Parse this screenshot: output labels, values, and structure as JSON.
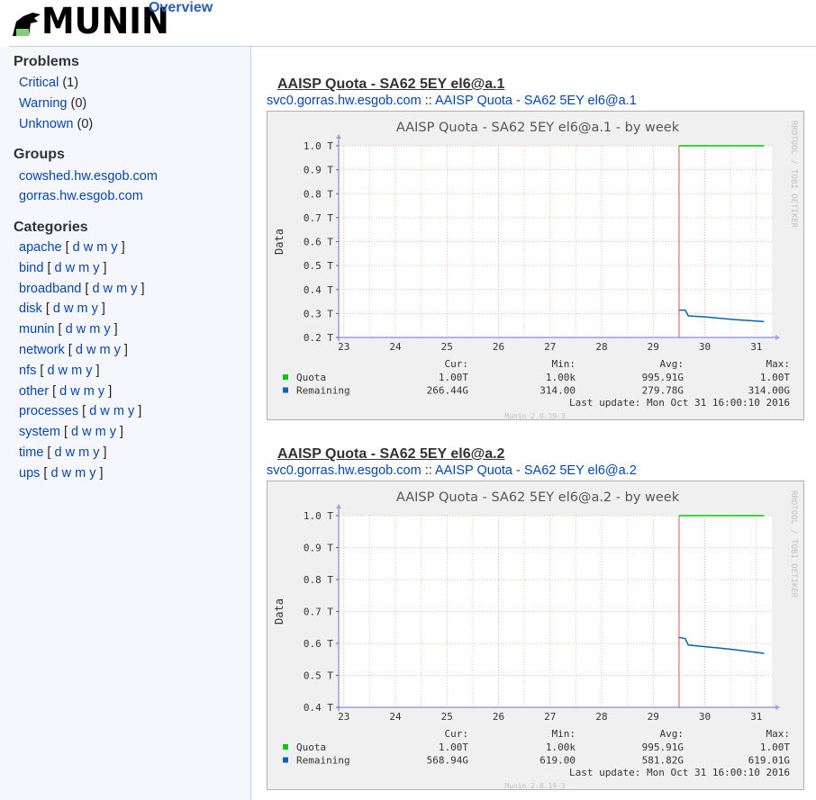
{
  "header": {
    "logo_text": "MUNIN",
    "overview_label": "Overview"
  },
  "sidebar": {
    "problems": {
      "heading": "Problems",
      "items": [
        {
          "label": "Critical",
          "count": "(1)"
        },
        {
          "label": "Warning",
          "count": "(0)"
        },
        {
          "label": "Unknown",
          "count": "(0)"
        }
      ]
    },
    "groups": {
      "heading": "Groups",
      "items": [
        "cowshed.hw.esgob.com",
        "gorras.hw.esgob.com"
      ]
    },
    "categories": {
      "heading": "Categories",
      "period_links": [
        "d",
        "w",
        "m",
        "y"
      ],
      "items": [
        "apache",
        "bind",
        "broadband",
        "disk",
        "munin",
        "network",
        "nfs",
        "other",
        "processes",
        "system",
        "time",
        "ups"
      ]
    }
  },
  "graphs": [
    {
      "title": "AAISP Quota - SA62 5EY el6@a.1",
      "crumb_host": "svc0.gorras.hw.esgob.com",
      "crumb_sep": "::",
      "crumb_service": "AAISP Quota - SA62 5EY el6@a.1",
      "chart_data": {
        "type": "line",
        "title": "AAISP Quota - SA62 5EY el6@a.1 - by week",
        "ylabel": "Data",
        "xlabel": "",
        "x_ticks": [
          "23",
          "24",
          "25",
          "26",
          "27",
          "28",
          "29",
          "30",
          "31"
        ],
        "y_ticks": [
          "1.0 T",
          "0.9 T",
          "0.8 T",
          "0.7 T",
          "0.6 T",
          "0.5 T",
          "0.4 T",
          "0.3 T",
          "0.2 T"
        ],
        "ylim": [
          0.2,
          1.0
        ],
        "xlim": [
          22.9,
          31.3
        ],
        "side_text": "RRDTOOL / TOBI OETIKER",
        "series": [
          {
            "name": "Quota",
            "color": "#00cc00",
            "x": [
              29.5,
              30.0,
              30.5,
              31.0,
              31.15
            ],
            "y": [
              1.0,
              1.0,
              1.0,
              1.0,
              1.0
            ]
          },
          {
            "name": "Remaining",
            "color": "#0066b3",
            "x": [
              29.5,
              29.62,
              29.68,
              29.85,
              30.0,
              30.3,
              30.6,
              30.9,
              31.15
            ],
            "y": [
              0.314,
              0.314,
              0.29,
              0.288,
              0.286,
              0.28,
              0.274,
              0.27,
              0.266
            ]
          }
        ],
        "stats_headers": [
          "Cur:",
          "Min:",
          "Avg:",
          "Max:"
        ],
        "stats": [
          {
            "name": "Quota",
            "values": [
              "1.00T",
              "1.00k",
              "995.91G",
              "1.00T"
            ]
          },
          {
            "name": "Remaining",
            "values": [
              "266.44G",
              "314.00",
              "279.78G",
              "314.00G"
            ]
          }
        ],
        "last_update": "Last update:  Mon Oct 31 16:00:10 2016",
        "footer": "Munin 2.0.19-3"
      }
    },
    {
      "title": "AAISP Quota - SA62 5EY el6@a.2",
      "crumb_host": "svc0.gorras.hw.esgob.com",
      "crumb_sep": "::",
      "crumb_service": "AAISP Quota - SA62 5EY el6@a.2",
      "chart_data": {
        "type": "line",
        "title": "AAISP Quota - SA62 5EY el6@a.2 - by week",
        "ylabel": "Data",
        "xlabel": "",
        "x_ticks": [
          "23",
          "24",
          "25",
          "26",
          "27",
          "28",
          "29",
          "30",
          "31"
        ],
        "y_ticks": [
          "1.0 T",
          "0.9 T",
          "0.8 T",
          "0.7 T",
          "0.6 T",
          "0.5 T",
          "0.4 T"
        ],
        "ylim": [
          0.4,
          1.0
        ],
        "xlim": [
          22.9,
          31.3
        ],
        "side_text": "RRDTOOL / TOBI OETIKER",
        "series": [
          {
            "name": "Quota",
            "color": "#00cc00",
            "x": [
              29.5,
              30.0,
              30.5,
              31.0,
              31.15
            ],
            "y": [
              1.0,
              1.0,
              1.0,
              1.0,
              1.0
            ]
          },
          {
            "name": "Remaining",
            "color": "#0066b3",
            "x": [
              29.5,
              29.62,
              29.68,
              29.85,
              30.0,
              30.3,
              30.6,
              30.9,
              31.15
            ],
            "y": [
              0.619,
              0.615,
              0.595,
              0.592,
              0.59,
              0.585,
              0.58,
              0.574,
              0.569
            ]
          }
        ],
        "stats_headers": [
          "Cur:",
          "Min:",
          "Avg:",
          "Max:"
        ],
        "stats": [
          {
            "name": "Quota",
            "values": [
              "1.00T",
              "1.00k",
              "995.91G",
              "1.00T"
            ]
          },
          {
            "name": "Remaining",
            "values": [
              "568.94G",
              "619.00",
              "581.82G",
              "619.01G"
            ]
          }
        ],
        "last_update": "Last update:  Mon Oct 31 16:00:10 2016",
        "footer": "Munin 2.0.19-3"
      }
    }
  ]
}
